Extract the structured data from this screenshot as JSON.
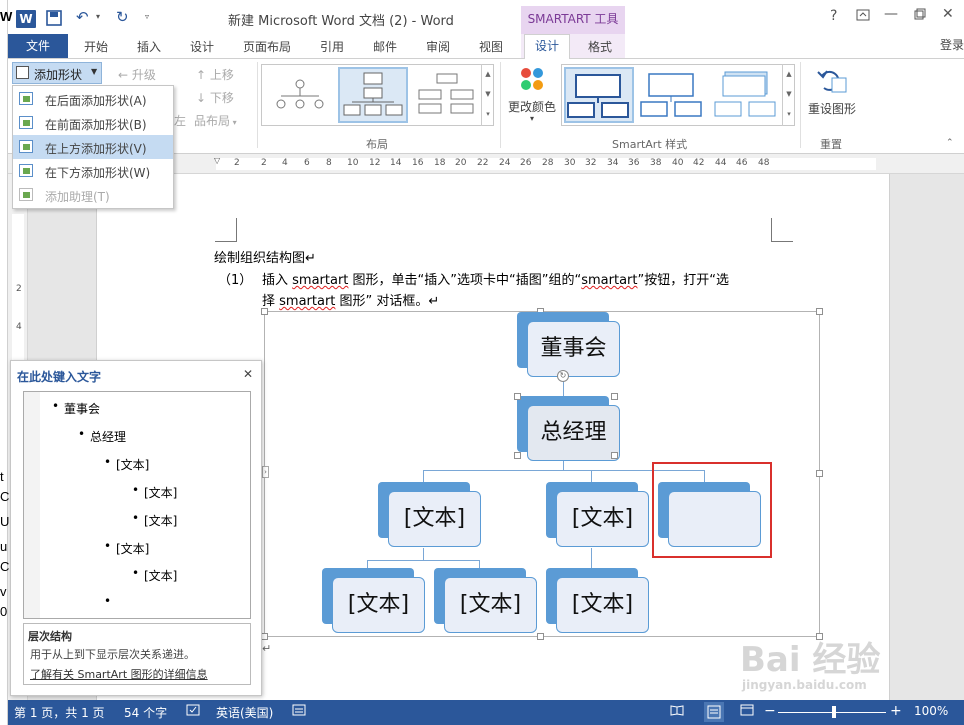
{
  "window": {
    "title": "新建 Microsoft Word 文档 (2) - Word",
    "context_tab_group": "SMARTART 工具",
    "help": "?",
    "login": "登录",
    "left_strip_chars": [
      "W",
      "t",
      "C",
      "U",
      "u",
      "C",
      "v",
      "0"
    ]
  },
  "tabs": [
    "文件",
    "开始",
    "插入",
    "设计",
    "页面布局",
    "引用",
    "邮件",
    "审阅",
    "视图",
    "设计",
    "格式"
  ],
  "ribbon": {
    "add_shape": "添加形状",
    "promote": "升级",
    "move_up": "上移",
    "move_down": "下移",
    "layout_btn": "布局",
    "right_to_left": "左",
    "change_colors": "更改颜色",
    "reset_graphic": "重设图形",
    "group_layout": "布局",
    "group_styles": "SmartArt 样式",
    "group_reset": "重置"
  },
  "add_shape_menu": [
    {
      "label": "在后面添加形状(A)",
      "enabled": true
    },
    {
      "label": "在前面添加形状(B)",
      "enabled": true
    },
    {
      "label": "在上方添加形状(V)",
      "enabled": true,
      "highlighted": true
    },
    {
      "label": "在下方添加形状(W)",
      "enabled": true
    },
    {
      "label": "添加助理(T)",
      "enabled": false
    }
  ],
  "ruler": {
    "h_numbers": [
      "2",
      "2",
      "4",
      "6",
      "8",
      "10",
      "12",
      "14",
      "16",
      "18",
      "20",
      "22",
      "24",
      "26",
      "28",
      "30",
      "32",
      "34",
      "36",
      "38",
      "40",
      "42",
      "44",
      "46",
      "48"
    ],
    "v_numbers": [
      "2",
      "4"
    ]
  },
  "document": {
    "heading": "绘制组织结构图↵",
    "step_num": "（1）",
    "line1_a": "插入 ",
    "line1_b": "smartart",
    "line1_c": "  图形，单击“插入”选项卡中“插图”组的“",
    "line1_d": "smartart",
    "line1_e": "”按钮，打开“选",
    "line2_a": "择 ",
    "line2_b": "smartart",
    "line2_c": " 图形” 对话框。↵",
    "end_mark": "↵"
  },
  "smartart": {
    "root": "董事会",
    "manager": "总经理",
    "child_left": "[文本]",
    "child_mid": "[文本]",
    "child_new": "",
    "gc_1": "[文本]",
    "gc_2": "[文本]",
    "gc_3": "[文本]"
  },
  "text_pane": {
    "title": "在此处键入文字",
    "close": "✕",
    "items": [
      {
        "text": "董事会",
        "level": 0
      },
      {
        "text": "总经理",
        "level": 1
      },
      {
        "text": "[文本]",
        "level": 2
      },
      {
        "text": "[文本]",
        "level": 3
      },
      {
        "text": "[文本]",
        "level": 3
      },
      {
        "text": "[文本]",
        "level": 2
      },
      {
        "text": "[文本]",
        "level": 3
      },
      {
        "text": "",
        "level": 2
      }
    ],
    "footer_title": "层次结构",
    "footer_desc": "用于从上到下显示层次关系递进。",
    "footer_link": "了解有关 SmartArt 图形的详细信息"
  },
  "status": {
    "page": "第 1 页，共 1 页",
    "words": "54 个字",
    "lang": "英语(美国)",
    "zoom": "100%"
  },
  "watermark": "Bai 经验",
  "watermark_url": "jingyan.baidu.com",
  "colors": {
    "accent": "#2b579a",
    "node_blue": "#5b9bd5",
    "node_fill": "#e9eef8",
    "highlight": "#d9302c",
    "context": "#e8d5f0"
  }
}
